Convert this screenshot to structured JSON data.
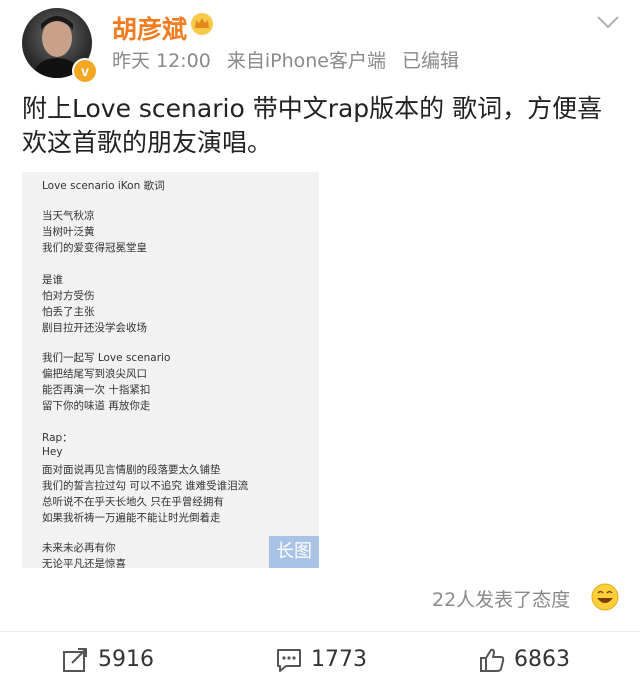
{
  "post": {
    "username": "胡彦斌",
    "time": "昨天 12:00",
    "source": "来自iPhone客户端",
    "edited": "已编辑",
    "text": "附上Love scenario 带中文rap版本的 歌词，方便喜欢这首歌的朋友演唱。"
  },
  "lyrics_image": {
    "lines": [
      "Love scenario   iKon 歌词",
      "当天气秋凉",
      "当树叶泛黄",
      "我们的爱变得冠冕堂皇",
      "是谁",
      "怕对方受伤",
      "怕丢了主张",
      "剧目拉开还没学会收场",
      "我们一起写 Love scenario",
      "偏把结尾写到浪尖风口",
      "能否再演一次 十指紧扣",
      "留下你的味道 再放你走",
      "Rap：",
      "Hey",
      "面对面说再见言情剧的段落要太久铺垫",
      "我们的誓言拉过勾 可以不追究 谁难受谁泪流",
      "总听说不在乎天长地久 只在乎曾经拥有",
      "如果我祈祷一万遍能不能让时光倒着走",
      "未来未必再有你",
      "无论平凡还是惊喜"
    ],
    "tag": "长图"
  },
  "reactions": {
    "text": "22人发表了态度"
  },
  "actions": {
    "repost": "5916",
    "comment": "1773",
    "like": "6863"
  },
  "colors": {
    "username": "#f47c20",
    "meta": "#8a8a8a",
    "tag": "#a9c3e6"
  },
  "icons": [
    "chevron-down-icon",
    "crown-icon",
    "verified-icon",
    "emoji-icon",
    "repost-icon",
    "comment-icon",
    "like-icon"
  ]
}
